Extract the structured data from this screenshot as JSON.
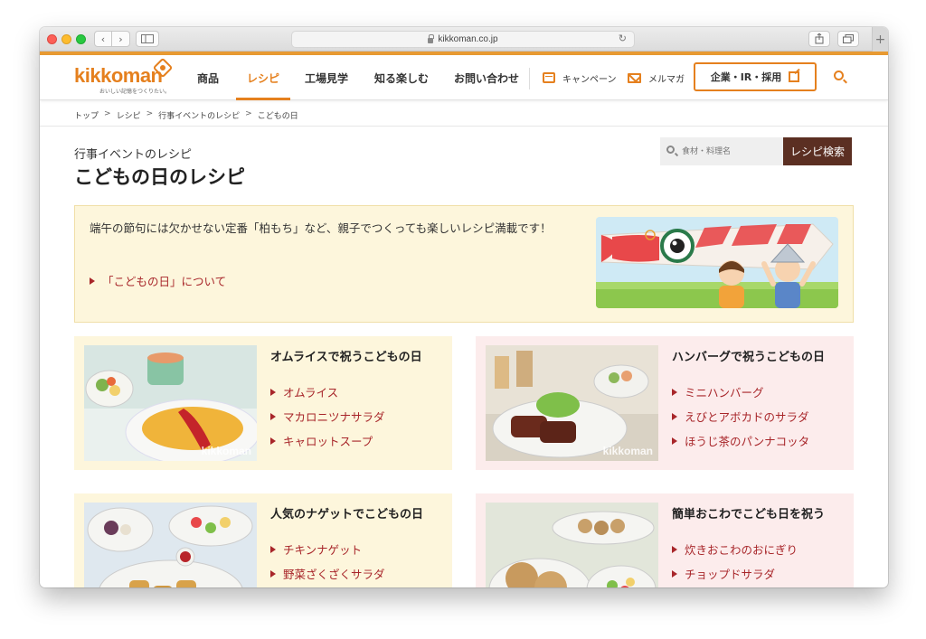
{
  "browser": {
    "url": "kikkoman.co.jp",
    "nav_back": "‹",
    "nav_forward": "›",
    "reload": "↻",
    "new_tab": "+"
  },
  "header": {
    "logo_text": "kikkoman",
    "logo_tagline": "おいしい記憶をつくりたい。",
    "nav": [
      "商品",
      "レシピ",
      "工場見学",
      "知る楽しむ",
      "お問い合わせ"
    ],
    "active_nav": "レシピ",
    "campaign_label": "キャンペーン",
    "mail_label": "メルマガ",
    "corp_label": "企業・IR・採用"
  },
  "breadcrumb": [
    "トップ",
    "レシピ",
    "行事イベントのレシピ",
    "こどもの日"
  ],
  "breadcrumb_sep": ">",
  "page": {
    "subtitle": "行事イベントのレシピ",
    "title": "こどもの日のレシピ",
    "search_placeholder": "食材・料理名",
    "search_button": "レシピ検索"
  },
  "intro": {
    "text": "端午の節句には欠かせない定番「柏もち」など、親子でつくっても楽しいレシピ満載です！",
    "link": "「こどもの日」について"
  },
  "cards": [
    {
      "title": "オムライスで祝うこどもの日",
      "items": [
        "オムライス",
        "マカロニツナサラダ",
        "キャロットスープ"
      ],
      "watermark": "kikkoman"
    },
    {
      "title": "ハンバーグで祝うこどもの日",
      "items": [
        "ミニハンバーグ",
        "えびとアボカドのサラダ",
        "ほうじ茶のパンナコッタ"
      ],
      "watermark": "kikkoman"
    },
    {
      "title": "人気のナゲットでこどもの日",
      "items": [
        "チキンナゲット",
        "野菜ざくざくサラダ"
      ]
    },
    {
      "title": "簡単おこわでこども日を祝う",
      "items": [
        "炊きおこわのおにぎり",
        "チョップドサラダ"
      ]
    }
  ],
  "colors": {
    "accent": "#e5801e",
    "link": "#a8262a",
    "search_button": "#5b2f22",
    "card_yellow": "#fdf6dc",
    "card_pink": "#fcecec"
  }
}
